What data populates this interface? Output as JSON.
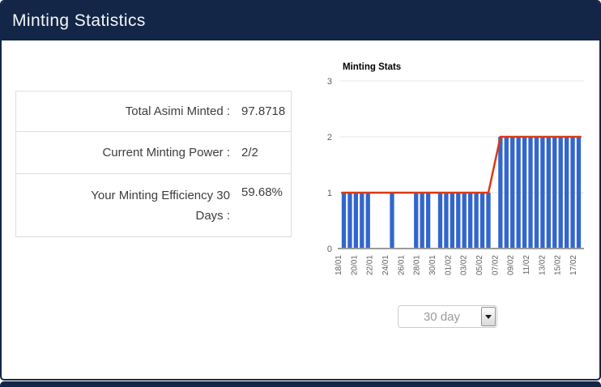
{
  "header": {
    "title": "Minting Statistics"
  },
  "stats_table": {
    "rows": [
      {
        "label": "Total Asimi Minted :",
        "value": "97.8718"
      },
      {
        "label": "Current Minting Power :",
        "value": "2/2"
      },
      {
        "label": "Your Minting Efficiency 30\nDays :",
        "value": "59.68%"
      }
    ]
  },
  "chart_data": {
    "type": "bar",
    "title": "Minting Stats",
    "xlabel": "",
    "ylabel": "",
    "ylim": [
      0,
      3
    ],
    "y_ticks": [
      0,
      1,
      2,
      3
    ],
    "grid": true,
    "legend": "none",
    "x_tick_labels": [
      "18/01",
      "20/01",
      "22/01",
      "24/01",
      "26/01",
      "28/01",
      "30/01",
      "01/02",
      "03/02",
      "05/02",
      "07/02",
      "09/02",
      "11/02",
      "13/02",
      "15/02",
      "17/02"
    ],
    "series": [
      {
        "name": "daily-minted-bars",
        "type": "bar",
        "color": "#3366cc",
        "values": [
          1,
          1,
          1,
          1,
          1,
          0,
          0,
          0,
          1,
          0,
          0,
          0,
          1,
          1,
          1,
          0,
          1,
          1,
          1,
          1,
          1,
          1,
          1,
          1,
          1,
          0,
          2,
          2,
          2,
          2,
          2,
          2,
          2,
          2,
          2,
          2,
          2,
          2,
          2,
          2
        ]
      },
      {
        "name": "minting-power-line",
        "type": "line",
        "color": "#dc3912",
        "values": [
          1,
          1,
          1,
          1,
          1,
          1,
          1,
          1,
          1,
          1,
          1,
          1,
          1,
          1,
          1,
          1,
          1,
          1,
          1,
          1,
          1,
          1,
          1,
          1,
          1,
          null,
          2,
          2,
          2,
          2,
          2,
          2,
          2,
          2,
          2,
          2,
          2,
          2,
          2,
          2
        ]
      }
    ]
  },
  "controls": {
    "range_select_value": "30 day"
  },
  "colors": {
    "navy": "#132647",
    "bar_blue": "#3366cc",
    "line_red": "#dc3912",
    "grid_line": "#e7e7e7",
    "axis_baseline": "#9b9b9b",
    "tick_text": "#606060",
    "table_border": "#dddddd",
    "muted_text": "#9a9a9a"
  }
}
